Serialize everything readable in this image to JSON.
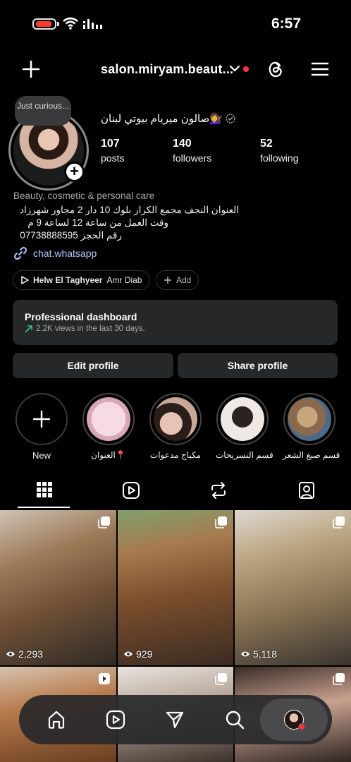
{
  "status_bar": {
    "time": "6:57",
    "battery_color": "#ff3b30"
  },
  "header": {
    "username": "salon.miryam.beaut...",
    "icons": [
      "plus-icon",
      "chevron-down-icon",
      "threads-icon",
      "menu-icon"
    ]
  },
  "profile": {
    "note": "Just curious...",
    "display_name": "صالون ميريام بيوتي لبنان💇‍♀️",
    "stats": [
      {
        "value": "107",
        "label": "posts"
      },
      {
        "value": "140",
        "label": "followers"
      },
      {
        "value": "52",
        "label": "following"
      }
    ],
    "category": "Beauty, cosmetic & personal care",
    "bio_lines": [
      "العنوان النجف مجمع الكرار بلوك 10 دار 2 مجاور شهرزاد",
      "وقت العمل من ساعة 12 لساعة 9 م",
      "رقم الحجز 07738888595"
    ],
    "link": "chat.whatsapp"
  },
  "music_chip": {
    "title": "Helw El Taghyeer",
    "artist": "Amr Diab"
  },
  "add_chip": "Add",
  "dashboard": {
    "title": "Professional dashboard",
    "subtitle": "2.2K views in the last 30 days.",
    "accent": "#2ecc71"
  },
  "buttons": {
    "edit": "Edit profile",
    "share": "Share profile"
  },
  "highlights": [
    {
      "label": "New"
    },
    {
      "label": "العنوان📍"
    },
    {
      "label": "مكياج مدعوات"
    },
    {
      "label": "قسم التسريحات"
    },
    {
      "label": "قسم صبغ الشعر"
    }
  ],
  "tabs": [
    "grid-icon",
    "reels-icon",
    "reposts-icon",
    "tagged-icon"
  ],
  "posts": [
    {
      "views": "2,293"
    },
    {
      "views": "929"
    },
    {
      "views": "5,118"
    },
    {
      "views": ""
    },
    {
      "views": ""
    },
    {
      "views": ""
    }
  ],
  "bottom_nav": [
    "home-icon",
    "reels-icon",
    "send-icon",
    "search-icon",
    "profile-avatar"
  ]
}
